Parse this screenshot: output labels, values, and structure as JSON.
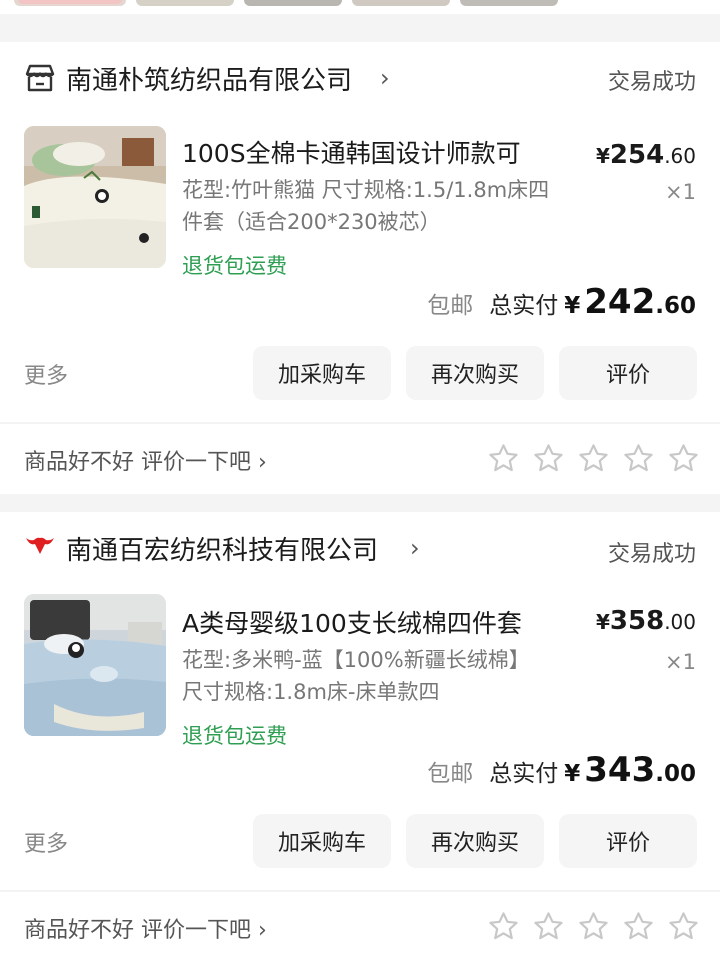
{
  "orders": [
    {
      "shop_name": "南通朴筑纺织品有限公司",
      "shop_icon": "store-icon",
      "status": "交易成功",
      "product_title": "100S全棉卡通韩国设计师款可",
      "spec": "花型:竹叶熊猫 尺寸规格:1.5/1.8m床四件套（适合200*230被芯）",
      "refund_tag": "退货包运费",
      "price_yen": "¥",
      "price_int": "254",
      "price_dec": ".60",
      "qty": "×1",
      "free_shipping": "包邮",
      "total_label": "总实付",
      "total_yen": "¥",
      "total_int": "242",
      "total_dec": ".60",
      "more": "更多",
      "btn_cart": "加采购车",
      "btn_rebuy": "再次购买",
      "btn_review": "评价",
      "rate_prompt": "商品好不好 评价一下吧"
    },
    {
      "shop_name": "南通百宏纺织科技有限公司",
      "shop_icon": "bull-icon",
      "status": "交易成功",
      "product_title": "A类母婴级100支长绒棉四件套",
      "spec": "花型:多米鸭-蓝【100%新疆长绒棉】 尺寸规格:1.8m床-床单款四",
      "refund_tag": "退货包运费",
      "price_yen": "¥",
      "price_int": "358",
      "price_dec": ".00",
      "qty": "×1",
      "free_shipping": "包邮",
      "total_label": "总实付",
      "total_yen": "¥",
      "total_int": "343",
      "total_dec": ".00",
      "more": "更多",
      "btn_cart": "加采购车",
      "btn_rebuy": "再次购买",
      "btn_review": "评价",
      "rate_prompt": "商品好不好 评价一下吧"
    }
  ],
  "colors": {
    "refund_green": "#2e9e52",
    "bull_red": "#e02020",
    "star_outline": "#c8c8c8"
  }
}
